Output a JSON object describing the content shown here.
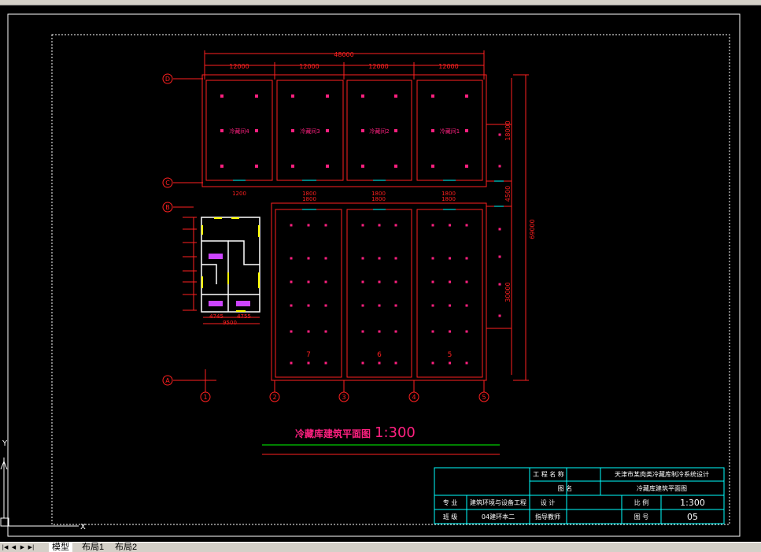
{
  "drawing": {
    "total_dim": "48000",
    "bay_dims": [
      "12000",
      "12000",
      "12000",
      "12000"
    ],
    "axes_letters": [
      "D",
      "C",
      "B",
      "A"
    ],
    "axes_numbers": [
      "1",
      "2",
      "3",
      "4",
      "5"
    ],
    "upper_rooms": [
      "冷藏间4",
      "冷藏间3",
      "冷藏间2",
      "冷藏间1"
    ],
    "lower_rooms": [
      "7",
      "6",
      "5"
    ],
    "door_labels": [
      {
        "top": "1200",
        "bottom": ""
      },
      {
        "top": "1800",
        "bottom": "1800"
      },
      {
        "top": "1800",
        "bottom": "1800"
      },
      {
        "top": "1800",
        "bottom": "1800"
      }
    ],
    "right_dims": {
      "overall": "69000",
      "upper": "18000",
      "mid": "4500",
      "lower": "30000"
    },
    "aux_dims": {
      "total": "9500",
      "left": "4745",
      "right": "4755"
    },
    "title": "冷藏库建筑平面图",
    "scale": "1:300"
  },
  "title_block": {
    "project_label": "工 程 名 称",
    "project_value": "天津市某肉类冷藏库制冷系统设计",
    "drawing_label": "图     名",
    "drawing_value": "冷藏库建筑平面图",
    "major_label": "专  业",
    "major_value": "建筑环境与设备工程",
    "design_label": "设  计",
    "ratio_label": "比    例",
    "ratio_value": "1:300",
    "class_label": "班  级",
    "class_value": "04建环本二",
    "advisor_label": "指导教师",
    "sheet_label": "图    号",
    "sheet_value": "05"
  },
  "ucs": {
    "x": "X",
    "y": "Y"
  },
  "tabs": [
    "模型",
    "布局1",
    "布局2"
  ],
  "colors": {
    "red": "#ff2020",
    "magenta": "#ff2080",
    "cyan": "#00ffff",
    "white": "#ffffff",
    "green": "#00ff00",
    "yellow": "#ffff00"
  }
}
